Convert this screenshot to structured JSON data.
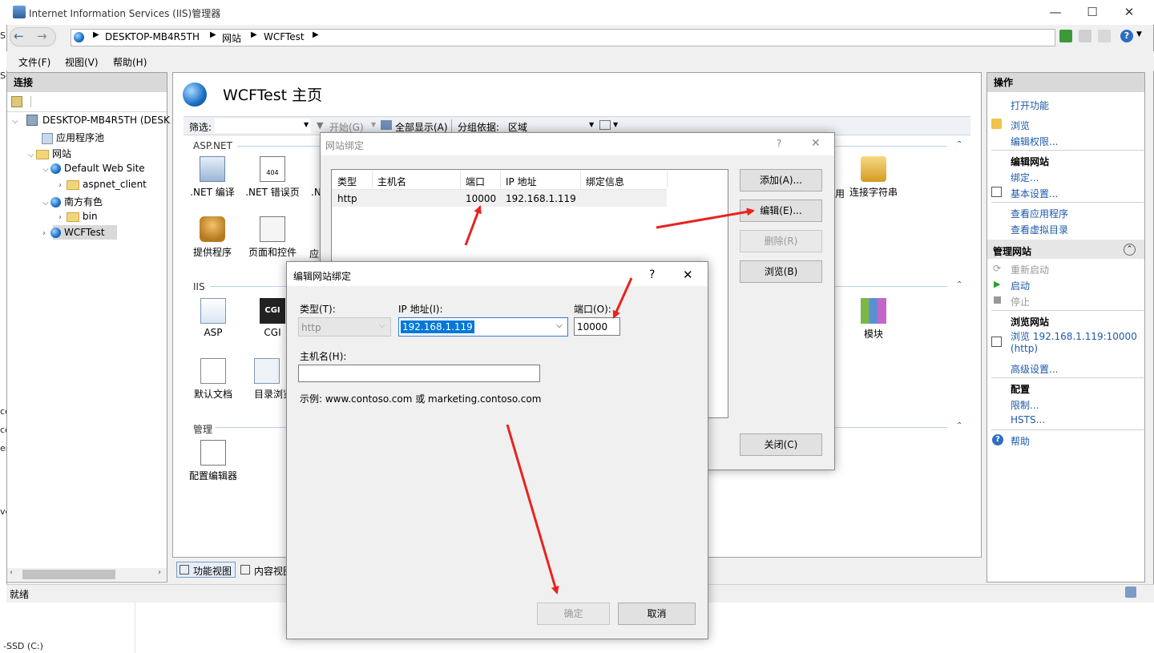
{
  "background": {
    "left_fragments": [
      "S",
      "Se",
      "ce",
      "ce",
      "er",
      "ve"
    ],
    "drive_label": "-SSD (C:)"
  },
  "window": {
    "title": "Internet Information Services (IIS)管理器",
    "controls": [
      "—",
      "☐",
      "✕"
    ]
  },
  "address_bar": {
    "crumbs": [
      "DESKTOP-MB4R5TH",
      "网站",
      "WCFTest"
    ]
  },
  "menu": {
    "items": [
      "文件(F)",
      "视图(V)",
      "帮助(H)"
    ]
  },
  "connections": {
    "title": "连接",
    "tree": [
      {
        "label": "DESKTOP-MB4R5TH (DESK",
        "level": 0,
        "icon": "server-icon",
        "expanded": true
      },
      {
        "label": "应用程序池",
        "level": 1,
        "icon": "app-pool-icon"
      },
      {
        "label": "网站",
        "level": 1,
        "icon": "folder-icon",
        "expanded": true
      },
      {
        "label": "Default Web Site",
        "level": 2,
        "icon": "globe-icon",
        "expanded": true
      },
      {
        "label": "aspnet_client",
        "level": 3,
        "icon": "folder-icon"
      },
      {
        "label": "南方有色",
        "level": 2,
        "icon": "globe-icon",
        "expanded": true
      },
      {
        "label": "bin",
        "level": 3,
        "icon": "folder-icon"
      },
      {
        "label": "WCFTest",
        "level": 2,
        "icon": "globe-icon",
        "selected": true
      }
    ]
  },
  "center": {
    "page_title": "WCFTest 主页",
    "filter_label": "筛选:",
    "start_label": "开始(G)",
    "show_all_label": "全部显示(A)",
    "group_by_label": "分组依据:",
    "group_by_value": "区域",
    "sections": {
      "aspnet": "ASP.NET",
      "iis": "IIS",
      "management": "管理"
    },
    "features_aspnet": [
      ".NET 编译",
      ".NET 错误页",
      ".N",
      "提供程序",
      "页面和控件",
      "应",
      "连接字符串",
      "用"
    ],
    "features_iis": [
      "ASP",
      "CGI",
      "默认文档",
      "目录浏览",
      "模块"
    ],
    "features_mgmt": [
      "配置编辑器"
    ],
    "view_tabs": [
      "功能视图",
      "内容视图"
    ]
  },
  "actions": {
    "title": "操作",
    "items": [
      {
        "type": "link",
        "label": "打开功能"
      },
      {
        "type": "link",
        "label": "浏览"
      },
      {
        "type": "link",
        "label": "编辑权限..."
      },
      {
        "type": "header",
        "label": "编辑网站"
      },
      {
        "type": "link",
        "label": "绑定..."
      },
      {
        "type": "link",
        "label": "基本设置..."
      },
      {
        "type": "link",
        "label": "查看应用程序"
      },
      {
        "type": "link",
        "label": "查看虚拟目录"
      },
      {
        "type": "header",
        "label": "管理网站"
      },
      {
        "type": "disabled",
        "label": "重新启动"
      },
      {
        "type": "link",
        "label": "启动"
      },
      {
        "type": "disabled",
        "label": "停止"
      },
      {
        "type": "header",
        "label": "浏览网站"
      },
      {
        "type": "link",
        "label": "浏览 192.168.1.119:10000"
      },
      {
        "type": "link",
        "label": "(http)"
      },
      {
        "type": "link",
        "label": "高级设置..."
      },
      {
        "type": "header",
        "label": "配置"
      },
      {
        "type": "link",
        "label": "限制..."
      },
      {
        "type": "link",
        "label": "HSTS..."
      },
      {
        "type": "link",
        "label": "帮助"
      }
    ]
  },
  "status": {
    "text": "就绪"
  },
  "binding_dialog": {
    "title": "网站绑定",
    "help": "?",
    "close": "✕",
    "columns": [
      "类型",
      "主机名",
      "端口",
      "IP 地址",
      "绑定信息"
    ],
    "rows": [
      {
        "type": "http",
        "host": "",
        "port": "10000",
        "ip": "192.168.1.119",
        "info": ""
      }
    ],
    "buttons": {
      "add": "添加(A)...",
      "edit": "编辑(E)...",
      "remove": "删除(R)",
      "browse": "浏览(B)",
      "close": "关闭(C)"
    }
  },
  "edit_dialog": {
    "title": "编辑网站绑定",
    "help": "?",
    "close": "✕",
    "type_label": "类型(T):",
    "type_value": "http",
    "ip_label": "IP 地址(I):",
    "ip_value": "192.168.1.119",
    "port_label": "端口(O):",
    "port_value": "10000",
    "host_label": "主机名(H):",
    "host_value": "",
    "example": "示例: www.contoso.com 或 marketing.contoso.com",
    "ok": "确定",
    "cancel": "取消"
  },
  "annotation_color": "#e8231f"
}
